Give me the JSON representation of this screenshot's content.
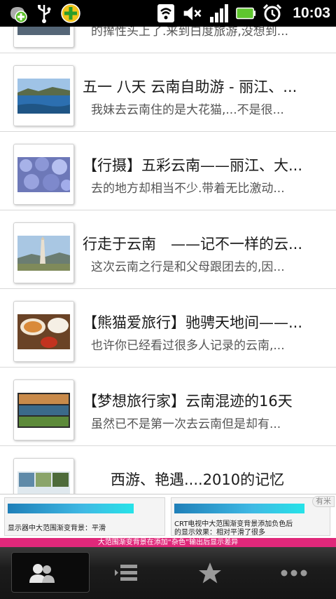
{
  "status_bar": {
    "time": "10:03",
    "left_icons": [
      "add-app-icon",
      "usb-icon",
      "plus-icon"
    ],
    "right_icons": [
      "wifi-icon",
      "muted-icon",
      "signal-icon",
      "battery-icon",
      "alarm-icon"
    ]
  },
  "list": {
    "items": [
      {
        "title": "",
        "subtitle": "的撵性头上了.来到白度旅游,没想到..."
      },
      {
        "title": "五一 八天 云南自助游 - 丽江、...",
        "subtitle": "我妹去云南住的是大花猫,...不是很..."
      },
      {
        "title": "【行摄】五彩云南——丽江、大...",
        "subtitle": "去的地方却相当不少.带着无比激动..."
      },
      {
        "title": "行走于云南　——记不一样的云...",
        "subtitle": "这次云南之行是和父母跟团去的,因..."
      },
      {
        "title": "【熊猫爱旅行】驰骋天地间——...",
        "subtitle": "也许你已经看过很多人记录的云南,..."
      },
      {
        "title": "【梦想旅行家】云南混迹的16天",
        "subtitle": "虽然已不是第一次去云南但是却有..."
      },
      {
        "title": "西游、艳遇....2010的记忆",
        "subtitle": ""
      }
    ]
  },
  "ad": {
    "left_text": "显示器中大范围渐变背景：平滑",
    "right_text_1": "CRT电视中大范围渐变背景添加负色后",
    "right_text_2": "的显示效果：相对平滑了很多",
    "strip_text": "大范围渐变背景在添加“杂色”输出后显示差异",
    "corner_label": "有米"
  },
  "tabs": [
    {
      "icon": "friends-icon",
      "active": true
    },
    {
      "icon": "list-icon",
      "active": false
    },
    {
      "icon": "star-icon",
      "active": false
    },
    {
      "icon": "more-icon",
      "active": false
    }
  ]
}
